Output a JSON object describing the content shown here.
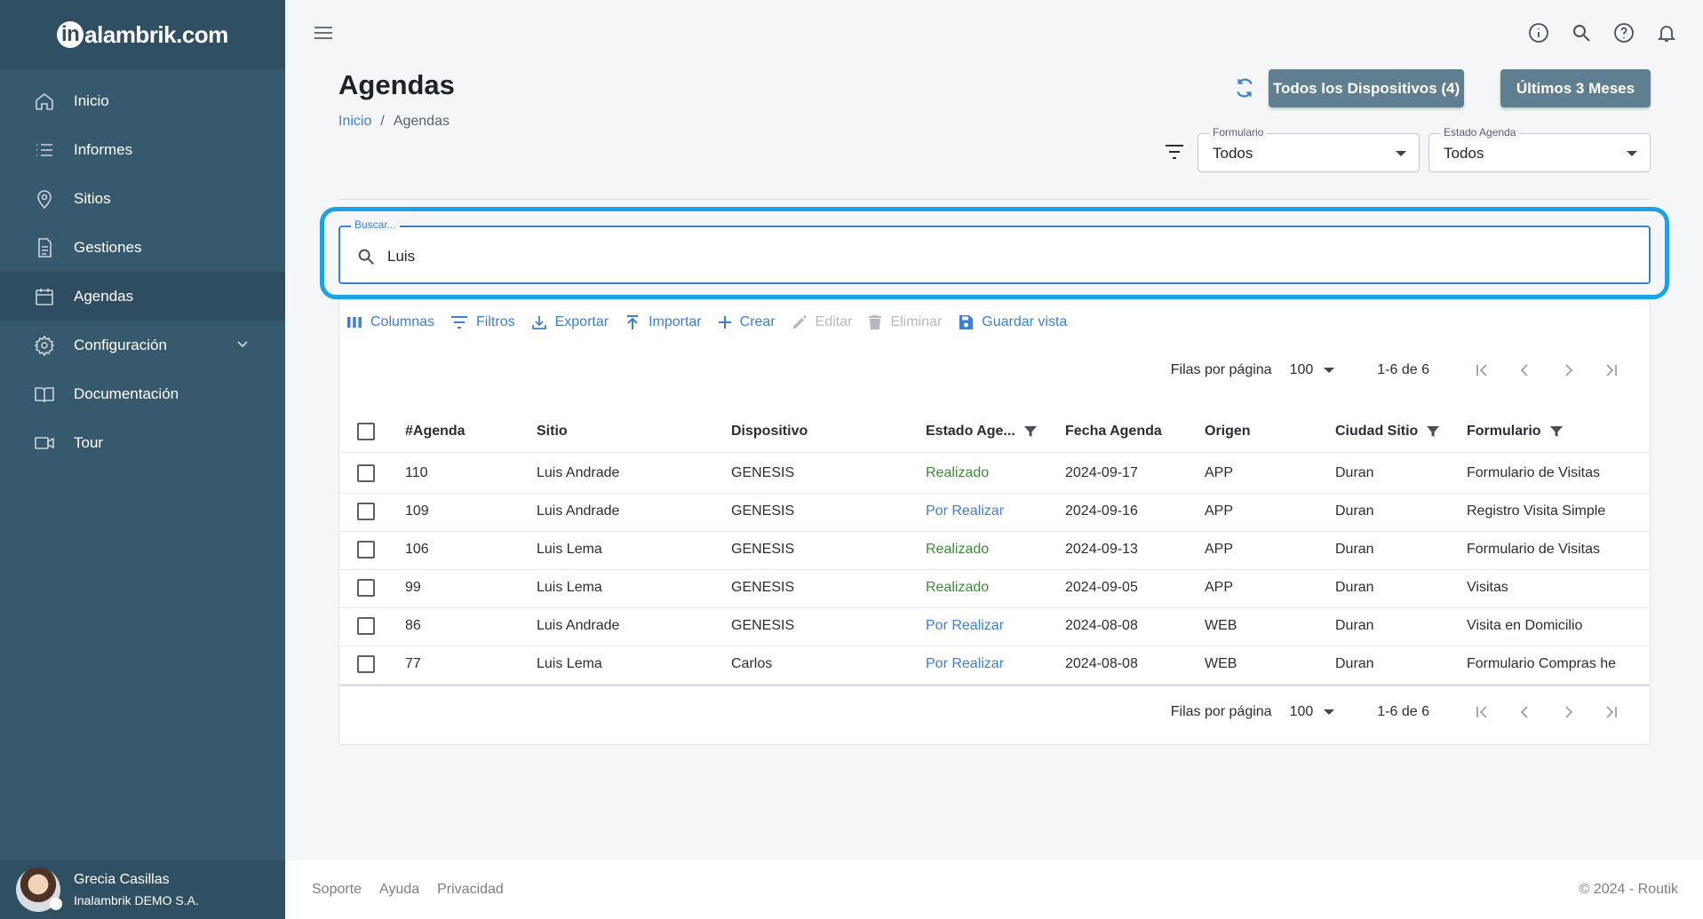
{
  "brand": {
    "logo_text": "alambrik.com",
    "logo_letter": "in"
  },
  "sidebar": {
    "items": [
      {
        "label": "Inicio",
        "icon": "home-icon"
      },
      {
        "label": "Informes",
        "icon": "list-icon"
      },
      {
        "label": "Sitios",
        "icon": "location-pin-icon"
      },
      {
        "label": "Gestiones",
        "icon": "document-icon"
      },
      {
        "label": "Agendas",
        "icon": "calendar-icon",
        "active": true
      },
      {
        "label": "Configuración",
        "icon": "gear-icon",
        "expandable": true
      },
      {
        "label": "Documentación",
        "icon": "book-icon"
      },
      {
        "label": "Tour",
        "icon": "video-camera-icon"
      }
    ],
    "user": {
      "name": "Grecia Casillas",
      "org": "Inalambrik DEMO S.A."
    }
  },
  "header": {
    "title": "Agendas",
    "breadcrumb": {
      "home": "Inicio",
      "sep": "/",
      "current": "Agendas"
    },
    "buttons": {
      "devices": "Todos los Dispositivos (4)",
      "period": "Últimos 3 Meses"
    },
    "filters": {
      "form": {
        "label": "Formulario",
        "value": "Todos"
      },
      "status": {
        "label": "Estado Agenda",
        "value": "Todos"
      }
    }
  },
  "search": {
    "label": "Buscar...",
    "value": "Luis"
  },
  "toolbar": {
    "columns": "Columnas",
    "filters": "Filtros",
    "export": "Exportar",
    "import": "Importar",
    "create": "Crear",
    "edit": "Editar",
    "delete": "Eliminar",
    "save_view": "Guardar vista"
  },
  "pagination": {
    "rows_label": "Filas por página",
    "rows_value": "100",
    "range": "1-6 de 6"
  },
  "table": {
    "columns": [
      "#Agenda",
      "Sitio",
      "Dispositivo",
      "Estado Age...",
      "Fecha Agenda",
      "Origen",
      "Ciudad Sitio",
      "Formulario"
    ],
    "rows": [
      {
        "id": "110",
        "sitio": "Luis Andrade",
        "dispositivo": "GENESIS",
        "estado": "Realizado",
        "fecha": "2024-09-17",
        "origen": "APP",
        "ciudad": "Duran",
        "formulario": "Formulario de Visitas"
      },
      {
        "id": "109",
        "sitio": "Luis Andrade",
        "dispositivo": "GENESIS",
        "estado": "Por Realizar",
        "fecha": "2024-09-16",
        "origen": "APP",
        "ciudad": "Duran",
        "formulario": "Registro Visita Simple"
      },
      {
        "id": "106",
        "sitio": "Luis Lema",
        "dispositivo": "GENESIS",
        "estado": "Realizado",
        "fecha": "2024-09-13",
        "origen": "APP",
        "ciudad": "Duran",
        "formulario": "Formulario de Visitas"
      },
      {
        "id": "99",
        "sitio": "Luis Lema",
        "dispositivo": "GENESIS",
        "estado": "Realizado",
        "fecha": "2024-09-05",
        "origen": "APP",
        "ciudad": "Duran",
        "formulario": "Visitas"
      },
      {
        "id": "86",
        "sitio": "Luis Andrade",
        "dispositivo": "GENESIS",
        "estado": "Por Realizar",
        "fecha": "2024-08-08",
        "origen": "WEB",
        "ciudad": "Duran",
        "formulario": "Visita en Domicilio"
      },
      {
        "id": "77",
        "sitio": "Luis Lema",
        "dispositivo": "Carlos",
        "estado": "Por Realizar",
        "fecha": "2024-08-08",
        "origen": "WEB",
        "ciudad": "Duran",
        "formulario": "Formulario Compras he"
      }
    ]
  },
  "footer": {
    "links": [
      "Soporte",
      "Ayuda",
      "Privacidad"
    ],
    "copyright": "© 2024 - Routik"
  },
  "colors": {
    "sidebar": "#36596e",
    "accent": "#3d7fd1",
    "highlight": "#1aa2e2",
    "done": "#3d8b37",
    "button": "#5f7e8f"
  }
}
